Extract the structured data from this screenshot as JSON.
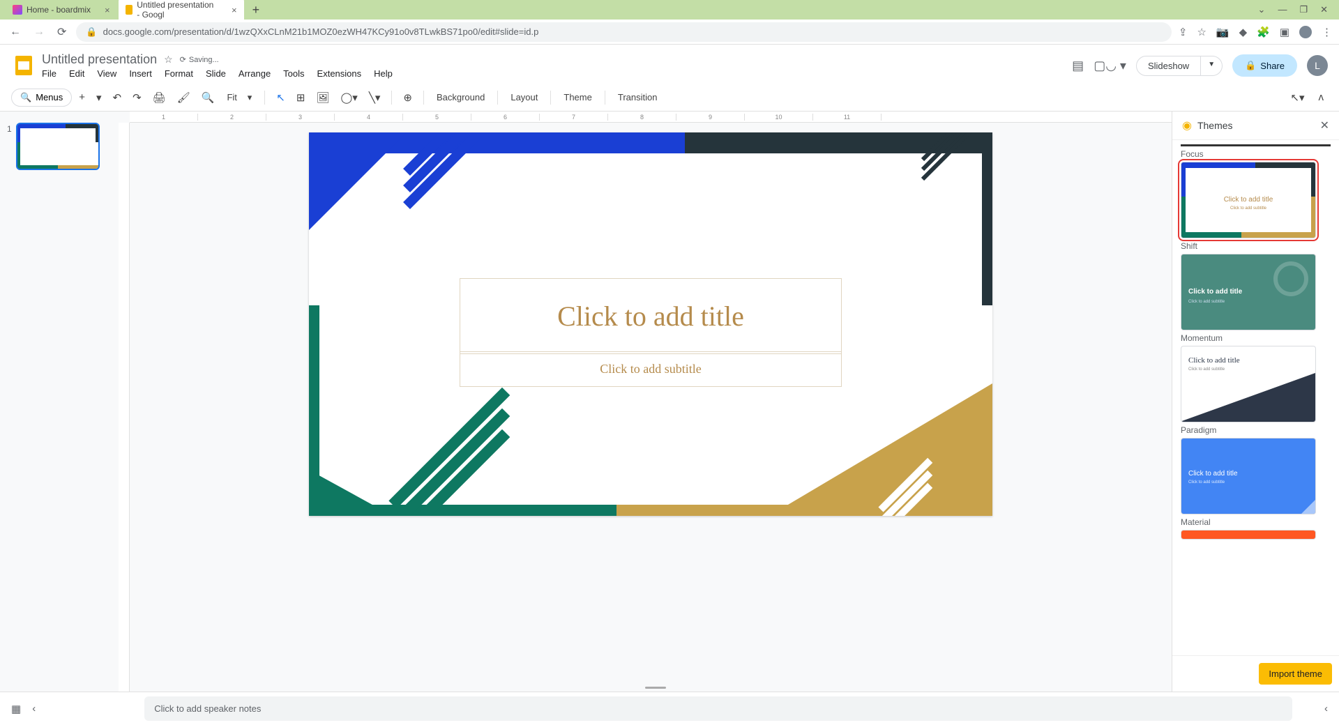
{
  "browser": {
    "tabs": [
      {
        "title": "Home - boardmix",
        "active": false
      },
      {
        "title": "Untitled presentation - Googl",
        "active": true
      }
    ],
    "url": "docs.google.com/presentation/d/1wzQXxCLnM21b1MOZ0ezWH47KCy91o0v8TLwkBS71po0/edit#slide=id.p"
  },
  "doc": {
    "title": "Untitled presentation",
    "saving": "Saving...",
    "avatar_letter": "L"
  },
  "menu": [
    "File",
    "Edit",
    "View",
    "Insert",
    "Format",
    "Slide",
    "Arrange",
    "Tools",
    "Extensions",
    "Help"
  ],
  "header_buttons": {
    "slideshow": "Slideshow",
    "share": "Share"
  },
  "toolbar": {
    "search": "Menus",
    "zoom": "Fit",
    "background": "Background",
    "layout": "Layout",
    "theme": "Theme",
    "transition": "Transition"
  },
  "slide": {
    "number": "1",
    "title_placeholder": "Click to add title",
    "subtitle_placeholder": "Click to add subtitle"
  },
  "themes_panel": {
    "title": "Themes",
    "themes": [
      "Focus",
      "Shift",
      "Momentum",
      "Paradigm",
      "Material"
    ],
    "preview_title": "Click to add title",
    "preview_sub": "Click to add subtitle",
    "import": "Import theme"
  },
  "notes": {
    "placeholder": "Click to add speaker notes"
  }
}
